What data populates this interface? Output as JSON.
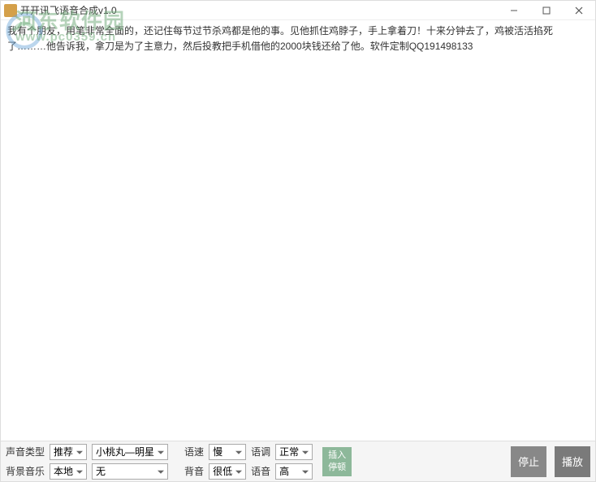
{
  "window": {
    "title": "开开讯飞语音合成v1.0"
  },
  "watermark": {
    "title": "河东软件园",
    "url": "www.pc0359.cn"
  },
  "textContent": "我有个朋友，用笔非常全面的，还记住每节过节杀鸡都是他的事。见他抓住鸡脖子，手上拿着刀！十来分钟去了，鸡被活活掐死了………他告诉我，拿刀是为了主意力，然后投教把手机借他的2000块钱还给了他。软件定制QQ191498133",
  "controls": {
    "voiceTypeLabel": "声音类型",
    "voiceTypeValue": "推荐",
    "voiceNameValue": "小桃丸—明星",
    "bgMusicLabel": "背景音乐",
    "bgMusicSourceValue": "本地",
    "bgMusicValue": "无",
    "speedLabel": "语速",
    "speedValue": "慢",
    "toneLabel": "语调",
    "toneValue": "正常",
    "bgVolumeLabel": "背音",
    "bgVolumeValue": "很低",
    "volumeLabel": "语音",
    "volumeValue": "高",
    "insertPause": "插入\n停顿",
    "stop": "停止",
    "play": "播放"
  }
}
